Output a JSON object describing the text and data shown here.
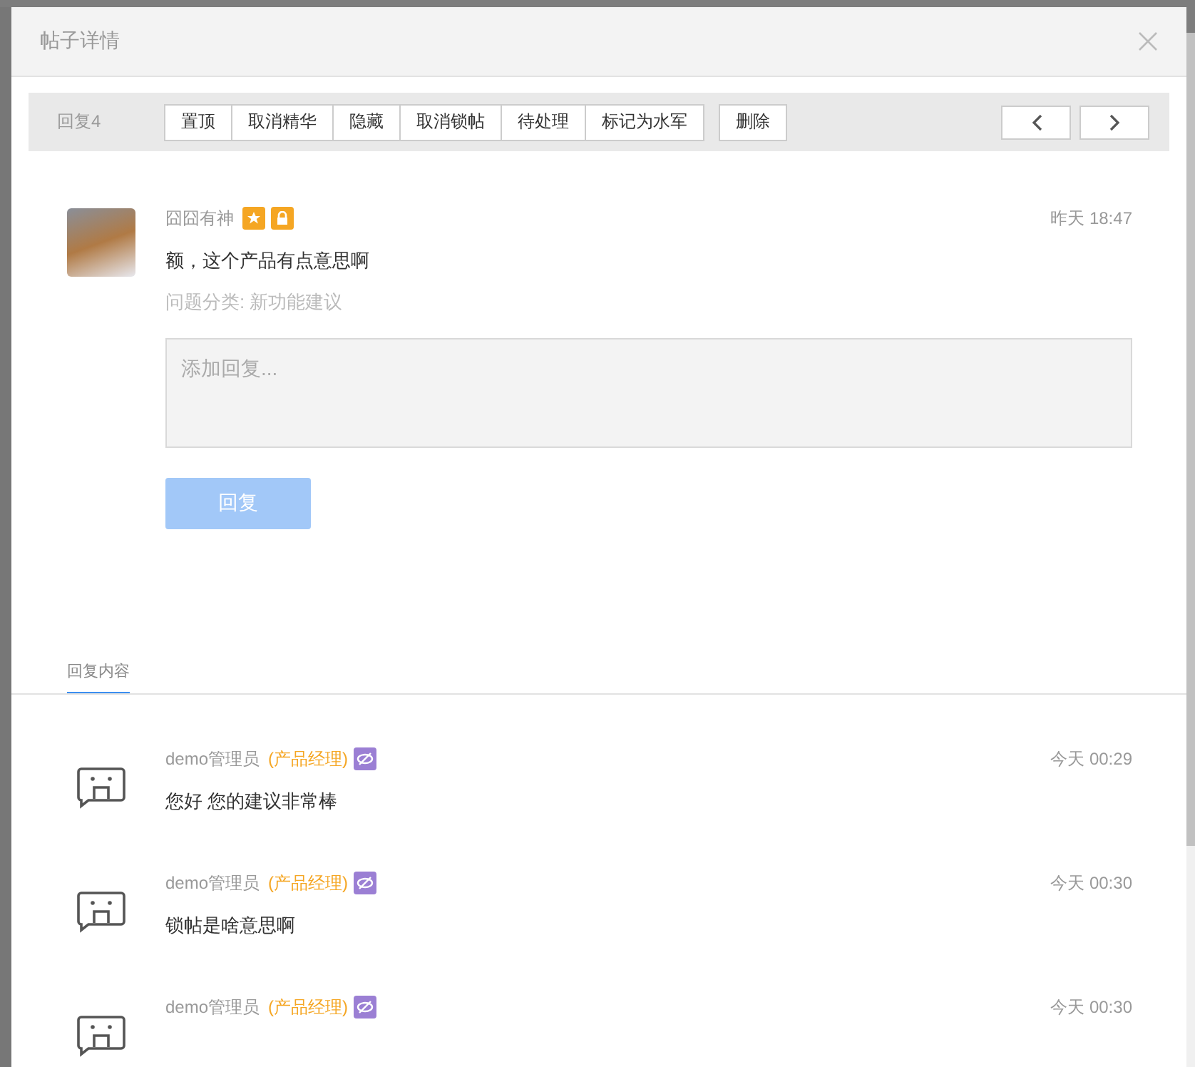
{
  "window": {
    "title": "帖子详情"
  },
  "toolbar": {
    "reply_count": "回复4",
    "actions": [
      "置顶",
      "取消精华",
      "隐藏",
      "取消锁帖",
      "待处理",
      "标记为水军"
    ],
    "delete": "删除"
  },
  "post": {
    "author": "囧囧有神",
    "time": "昨天 18:47",
    "content": "额，这个产品有点意思啊",
    "category": "问题分类: 新功能建议"
  },
  "reply_box": {
    "placeholder": "添加回复...",
    "button": "回复",
    "disabled": true
  },
  "tabs": [
    {
      "label": "回复内容",
      "selected": true
    }
  ],
  "replies": [
    {
      "author": "demo管理员",
      "role": "(产品经理)",
      "time": "今天 00:29",
      "text": "您好 您的建议非常棒"
    },
    {
      "author": "demo管理员",
      "role": "(产品经理)",
      "time": "今天 00:30",
      "text": "锁帖是啥意思啊"
    },
    {
      "author": "demo管理员",
      "role": "(产品经理)",
      "time": "今天 00:30"
    }
  ]
}
